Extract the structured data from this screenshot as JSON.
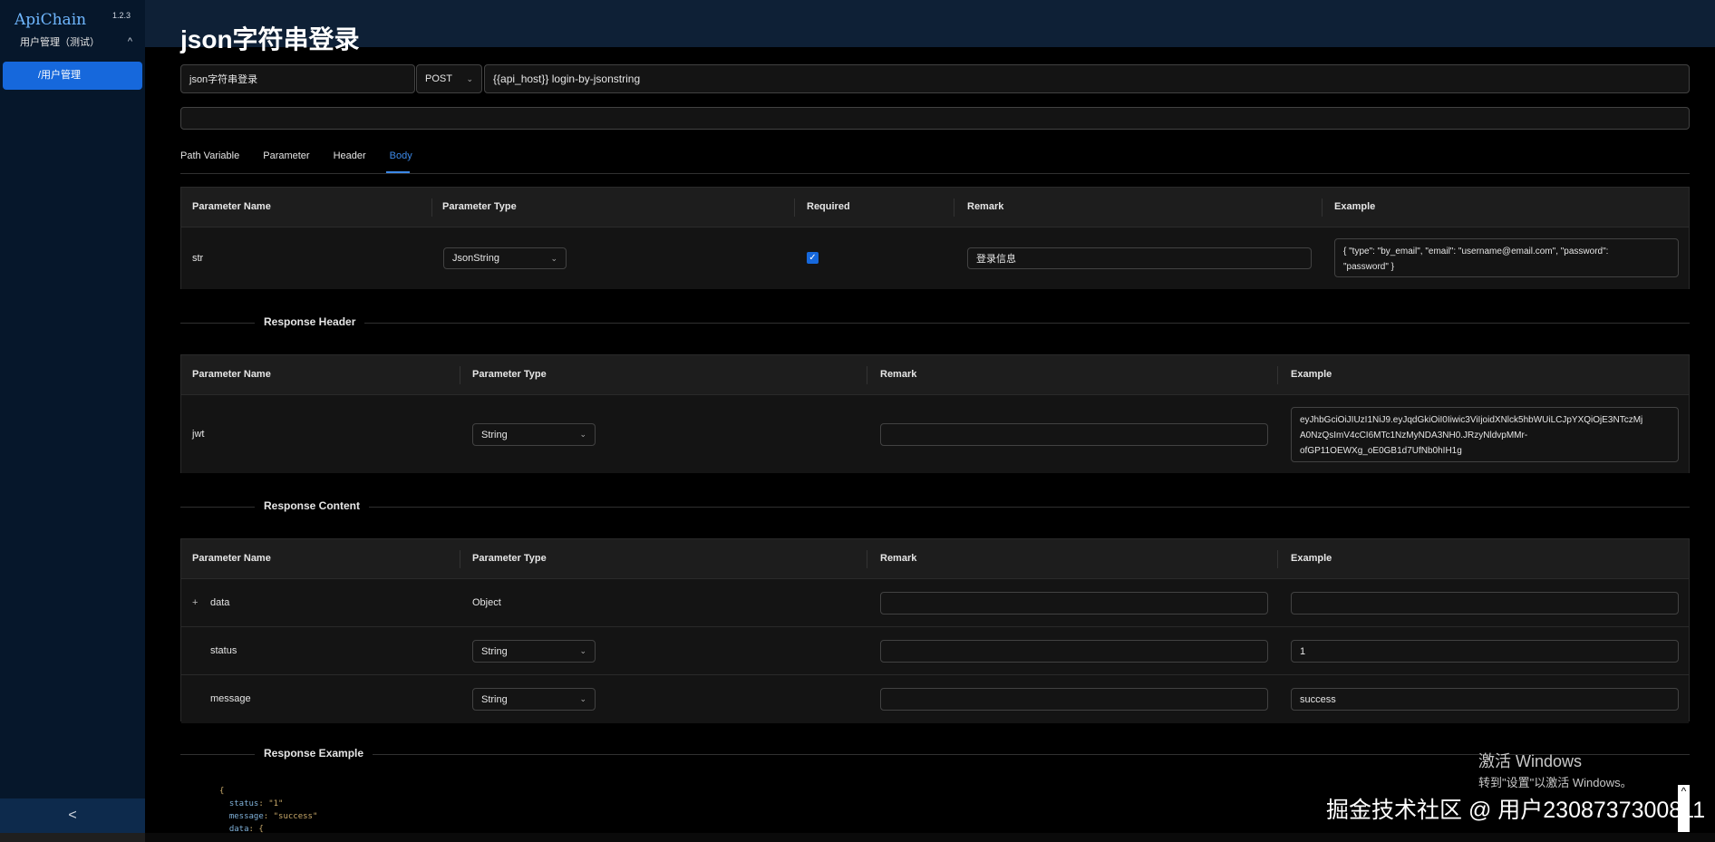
{
  "app": {
    "brand": "ApiChain",
    "version": "1.2.3",
    "group_label": "用户管理（测试）",
    "group_chevron": "^",
    "nav_items": [
      {
        "label": "/用户管理"
      }
    ],
    "collapse_label": "<"
  },
  "page": {
    "title": "json字符串登录"
  },
  "request": {
    "name": "json字符串登录",
    "method": "POST",
    "url": "{{api_host}} login-by-jsonstring",
    "description": ""
  },
  "tabs": [
    {
      "label": "Path Variable"
    },
    {
      "label": "Parameter"
    },
    {
      "label": "Header"
    },
    {
      "label": "Body",
      "active": true
    }
  ],
  "body_table": {
    "headers": [
      "Parameter Name",
      "Parameter Type",
      "Required",
      "Remark",
      "Example"
    ],
    "rows": [
      {
        "name": "str",
        "type": "JsonString",
        "required": true,
        "remark": "登录信息",
        "example_line1": "{      \"type\": \"by_email\",   \"email\": \"username@email.com\",   \"password\":",
        "example_line2": "\"password\" }"
      }
    ]
  },
  "response_header": {
    "title": "Response Header",
    "headers": [
      "Parameter Name",
      "Parameter Type",
      "Remark",
      "Example"
    ],
    "rows": [
      {
        "name": "jwt",
        "type": "String",
        "remark": "",
        "example_line1": "eyJhbGciOiJIUzI1NiJ9.eyJqdGkiOiI0Iiwic3ViIjoidXNlck5hbWUiLCJpYXQiOjE3NTczMj",
        "example_line2": "A0NzQsImV4cCI6MTc1NzMyNDA3NH0.JRzyNldvpMMr-",
        "example_line3": "ofGP11OEWXg_oE0GB1d7UfNb0hIH1g"
      }
    ]
  },
  "response_content": {
    "title": "Response Content",
    "headers": [
      "Parameter Name",
      "Parameter Type",
      "Remark",
      "Example"
    ],
    "rows": [
      {
        "expander": "+",
        "name": "data",
        "type": "Object",
        "remark": "",
        "example": ""
      },
      {
        "name": "status",
        "type": "String",
        "remark": "",
        "example": "1"
      },
      {
        "name": "message",
        "type": "String",
        "remark": "",
        "example": "success"
      }
    ]
  },
  "response_example": {
    "title": "Response Example",
    "line1": "{",
    "line2_key": "status",
    "line2_val": "\"1\"",
    "line3_key": "message",
    "line3_val": "\"success\"",
    "line4_key": "data",
    "line4_val": "{"
  },
  "overlays": {
    "activate_title": "激活 Windows",
    "activate_sub": "转到\"设置\"以激活 Windows。",
    "watermark": "掘金技术社区 @ 用户2308737300811",
    "scroll_top": "^"
  },
  "colors": {
    "accent": "#1668dc",
    "sidebar_bg": "#06172b",
    "topbar_bg": "#0e2036"
  }
}
